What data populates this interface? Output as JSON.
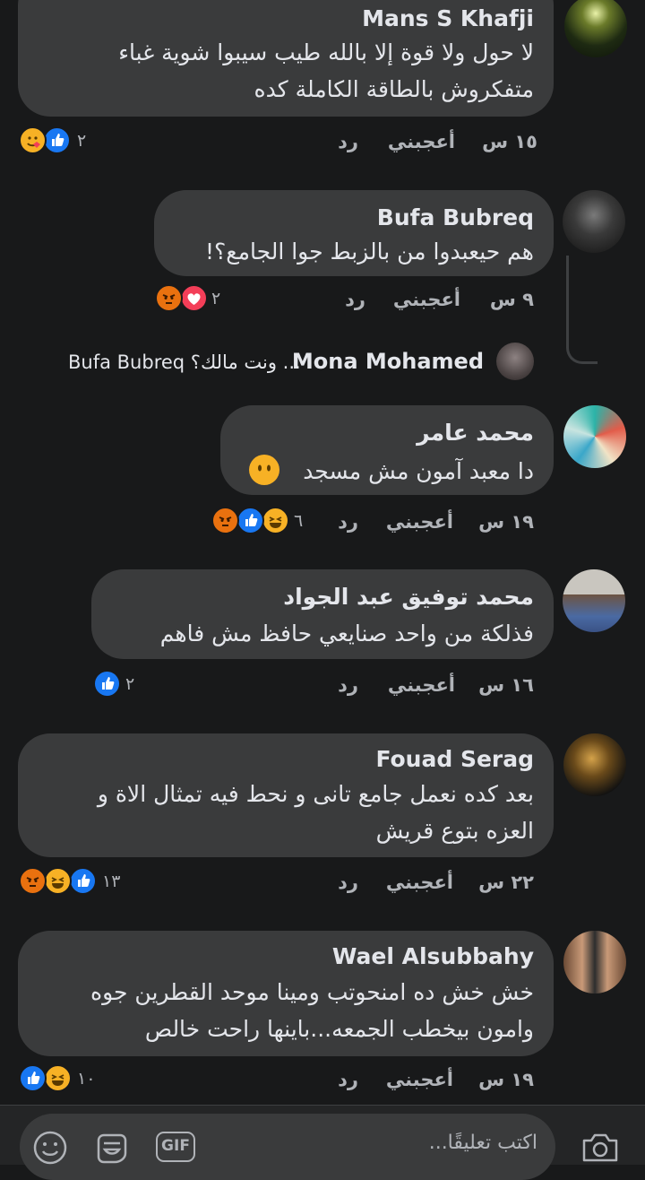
{
  "comments": [
    {
      "name": "Mans S Khafji",
      "lines": [
        "لا حول ولا قوة إلا بالله طيب سيبوا شوية غباء",
        "متفكروش بالطاقة الكاملة كده"
      ],
      "time": "١٥ س",
      "like": "أعجبني",
      "reply": "رد",
      "count": "٢",
      "reactions": [
        "haha-care-icon",
        "like-icon"
      ]
    },
    {
      "name": "Bufa Bubreq",
      "lines": [
        "هم حيعبدوا من بالزبط جوا الجامع؟!"
      ],
      "time": "٩ س",
      "like": "أعجبني",
      "reply": "رد",
      "count": "٢",
      "reactions": [
        "angry-icon",
        "love-icon"
      ]
    },
    {
      "name": "محمد عامر",
      "lines": [
        "دا معبد آمون مش مسجد"
      ],
      "time": "١٩ س",
      "like": "أعجبني",
      "reply": "رد",
      "count": "٦",
      "reactions": [
        "angry-icon",
        "like-icon",
        "haha-icon"
      ]
    },
    {
      "name": "محمد توفيق عبد الجواد",
      "lines": [
        "فذلكة  من واحد صنايعي  حافظ مش فاهم"
      ],
      "time": "١٦ س",
      "like": "أعجبني",
      "reply": "رد",
      "count": "٢",
      "reactions": [
        "like-icon"
      ]
    },
    {
      "name": "Fouad Serag",
      "lines": [
        "بعد كده نعمل جامع تانى و نحط فيه تمثال الاة و",
        "العزه بتوع قريش"
      ],
      "time": "٢٢ س",
      "like": "أعجبني",
      "reply": "رد",
      "count": "١٣",
      "reactions": [
        "angry-icon",
        "haha-icon",
        "like-icon"
      ]
    },
    {
      "name": "Wael Alsubbahy",
      "lines": [
        "خش خش ده امنحوتب ومينا موحد القطرين جوه",
        "وامون بيخطب الجمعه...باينها راحت خالص"
      ],
      "time": "١٩ س",
      "like": "أعجبني",
      "reply": "رد",
      "count": "١٠",
      "reactions": [
        "like-icon",
        "haha-icon"
      ]
    }
  ],
  "reply_preview": {
    "name": "Mona Mohamed",
    "text": "... ونت مالك؟ Bufa Bubreq"
  },
  "emoji_in_comment": "neutral-face-emoji",
  "composer": {
    "placeholder": "اكتب تعليقًا...",
    "gif_label": "GIF"
  },
  "colors": {
    "background": "#18191a",
    "bubble": "#3a3b3c",
    "like": "#1877f2",
    "love": "#f33e58",
    "haha": "#f7b125",
    "angry": "#e9710f"
  }
}
